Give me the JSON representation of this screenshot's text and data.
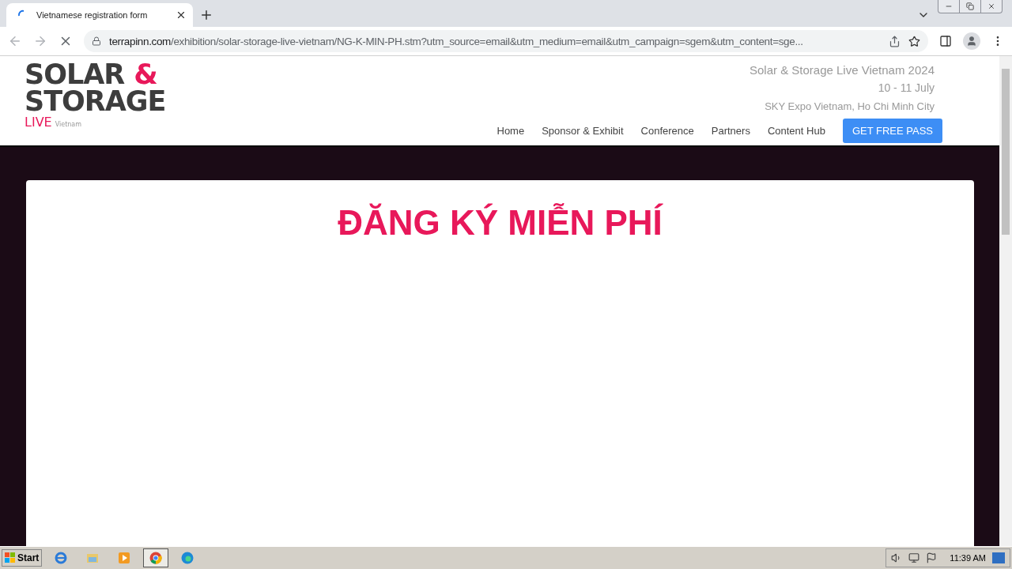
{
  "browser": {
    "tabs": [
      {
        "title": "Vietnamese registration form",
        "selected": true,
        "loading": true
      }
    ],
    "address": {
      "host": "terrapinn.com",
      "path": "/exhibition/solar-storage-live-vietnam/NG-K-MIN-PH.stm?utm_source=email&utm_medium=email&utm_campaign=sgem&utm_content=sge..."
    }
  },
  "header": {
    "logo": {
      "line_1": "SOLAR",
      "amp": "&",
      "line_2": "STORAGE",
      "live": "LIVE",
      "region": "Vietnam"
    },
    "event": {
      "name": "Solar & Storage Live Vietnam 2024",
      "dates": "10 - 11 July",
      "venue": "SKY Expo Vietnam, Ho Chi Minh City"
    },
    "nav": [
      "Home",
      "Sponsor & Exhibit",
      "Conference",
      "Partners",
      "Content Hub"
    ],
    "cta": "GET FREE PASS"
  },
  "form": {
    "title": "ĐĂNG KÝ MIỄN PHÍ"
  },
  "taskbar": {
    "start": "Start",
    "apps": [
      {
        "kind": "ie",
        "selected": false
      },
      {
        "kind": "explorer",
        "selected": false
      },
      {
        "kind": "media",
        "selected": false
      },
      {
        "kind": "chrome",
        "selected": true
      },
      {
        "kind": "edge",
        "selected": false
      }
    ],
    "clock": "11:39 AM"
  }
}
